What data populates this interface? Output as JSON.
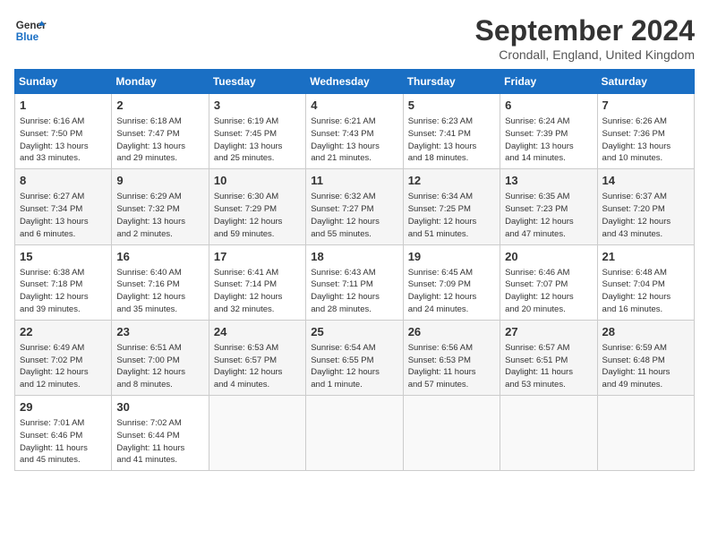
{
  "header": {
    "logo_line1": "General",
    "logo_line2": "Blue",
    "month": "September 2024",
    "location": "Crondall, England, United Kingdom"
  },
  "weekdays": [
    "Sunday",
    "Monday",
    "Tuesday",
    "Wednesday",
    "Thursday",
    "Friday",
    "Saturday"
  ],
  "weeks": [
    [
      {
        "day": "1",
        "info": "Sunrise: 6:16 AM\nSunset: 7:50 PM\nDaylight: 13 hours\nand 33 minutes."
      },
      {
        "day": "2",
        "info": "Sunrise: 6:18 AM\nSunset: 7:47 PM\nDaylight: 13 hours\nand 29 minutes."
      },
      {
        "day": "3",
        "info": "Sunrise: 6:19 AM\nSunset: 7:45 PM\nDaylight: 13 hours\nand 25 minutes."
      },
      {
        "day": "4",
        "info": "Sunrise: 6:21 AM\nSunset: 7:43 PM\nDaylight: 13 hours\nand 21 minutes."
      },
      {
        "day": "5",
        "info": "Sunrise: 6:23 AM\nSunset: 7:41 PM\nDaylight: 13 hours\nand 18 minutes."
      },
      {
        "day": "6",
        "info": "Sunrise: 6:24 AM\nSunset: 7:39 PM\nDaylight: 13 hours\nand 14 minutes."
      },
      {
        "day": "7",
        "info": "Sunrise: 6:26 AM\nSunset: 7:36 PM\nDaylight: 13 hours\nand 10 minutes."
      }
    ],
    [
      {
        "day": "8",
        "info": "Sunrise: 6:27 AM\nSunset: 7:34 PM\nDaylight: 13 hours\nand 6 minutes."
      },
      {
        "day": "9",
        "info": "Sunrise: 6:29 AM\nSunset: 7:32 PM\nDaylight: 13 hours\nand 2 minutes."
      },
      {
        "day": "10",
        "info": "Sunrise: 6:30 AM\nSunset: 7:29 PM\nDaylight: 12 hours\nand 59 minutes."
      },
      {
        "day": "11",
        "info": "Sunrise: 6:32 AM\nSunset: 7:27 PM\nDaylight: 12 hours\nand 55 minutes."
      },
      {
        "day": "12",
        "info": "Sunrise: 6:34 AM\nSunset: 7:25 PM\nDaylight: 12 hours\nand 51 minutes."
      },
      {
        "day": "13",
        "info": "Sunrise: 6:35 AM\nSunset: 7:23 PM\nDaylight: 12 hours\nand 47 minutes."
      },
      {
        "day": "14",
        "info": "Sunrise: 6:37 AM\nSunset: 7:20 PM\nDaylight: 12 hours\nand 43 minutes."
      }
    ],
    [
      {
        "day": "15",
        "info": "Sunrise: 6:38 AM\nSunset: 7:18 PM\nDaylight: 12 hours\nand 39 minutes."
      },
      {
        "day": "16",
        "info": "Sunrise: 6:40 AM\nSunset: 7:16 PM\nDaylight: 12 hours\nand 35 minutes."
      },
      {
        "day": "17",
        "info": "Sunrise: 6:41 AM\nSunset: 7:14 PM\nDaylight: 12 hours\nand 32 minutes."
      },
      {
        "day": "18",
        "info": "Sunrise: 6:43 AM\nSunset: 7:11 PM\nDaylight: 12 hours\nand 28 minutes."
      },
      {
        "day": "19",
        "info": "Sunrise: 6:45 AM\nSunset: 7:09 PM\nDaylight: 12 hours\nand 24 minutes."
      },
      {
        "day": "20",
        "info": "Sunrise: 6:46 AM\nSunset: 7:07 PM\nDaylight: 12 hours\nand 20 minutes."
      },
      {
        "day": "21",
        "info": "Sunrise: 6:48 AM\nSunset: 7:04 PM\nDaylight: 12 hours\nand 16 minutes."
      }
    ],
    [
      {
        "day": "22",
        "info": "Sunrise: 6:49 AM\nSunset: 7:02 PM\nDaylight: 12 hours\nand 12 minutes."
      },
      {
        "day": "23",
        "info": "Sunrise: 6:51 AM\nSunset: 7:00 PM\nDaylight: 12 hours\nand 8 minutes."
      },
      {
        "day": "24",
        "info": "Sunrise: 6:53 AM\nSunset: 6:57 PM\nDaylight: 12 hours\nand 4 minutes."
      },
      {
        "day": "25",
        "info": "Sunrise: 6:54 AM\nSunset: 6:55 PM\nDaylight: 12 hours\nand 1 minute."
      },
      {
        "day": "26",
        "info": "Sunrise: 6:56 AM\nSunset: 6:53 PM\nDaylight: 11 hours\nand 57 minutes."
      },
      {
        "day": "27",
        "info": "Sunrise: 6:57 AM\nSunset: 6:51 PM\nDaylight: 11 hours\nand 53 minutes."
      },
      {
        "day": "28",
        "info": "Sunrise: 6:59 AM\nSunset: 6:48 PM\nDaylight: 11 hours\nand 49 minutes."
      }
    ],
    [
      {
        "day": "29",
        "info": "Sunrise: 7:01 AM\nSunset: 6:46 PM\nDaylight: 11 hours\nand 45 minutes."
      },
      {
        "day": "30",
        "info": "Sunrise: 7:02 AM\nSunset: 6:44 PM\nDaylight: 11 hours\nand 41 minutes."
      },
      {
        "day": "",
        "info": ""
      },
      {
        "day": "",
        "info": ""
      },
      {
        "day": "",
        "info": ""
      },
      {
        "day": "",
        "info": ""
      },
      {
        "day": "",
        "info": ""
      }
    ]
  ]
}
